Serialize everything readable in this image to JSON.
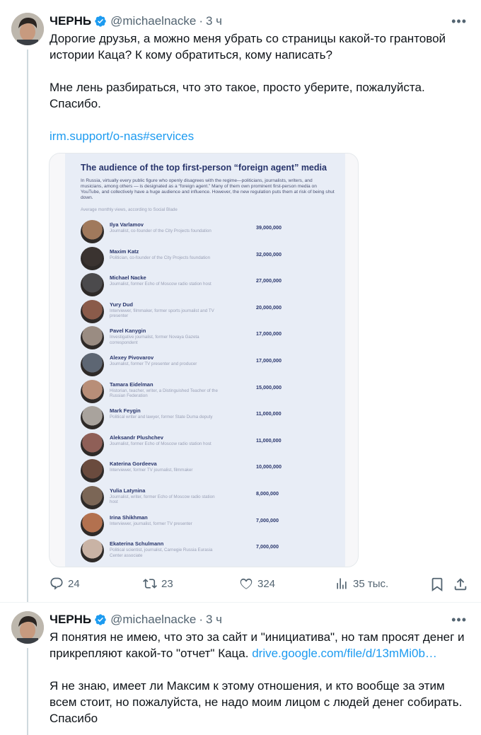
{
  "tweet1": {
    "author": {
      "name": "ЧЕРНЬ",
      "handle": "@michaelnacke",
      "time": "3 ч"
    },
    "paragraphs": [
      "Дорогие друзья, а можно меня убрать со страницы какой-то грантовой истории Каца? К кому обратиться, кому написать?",
      "Мне лень разбираться, что это такое, просто уберите, пожалуйста. Спасибо."
    ],
    "link": "irm.support/o-nas#services",
    "stats": {
      "replies": "24",
      "reposts": "23",
      "likes": "324",
      "views": "35 тыс."
    }
  },
  "infographic": {
    "title": "The audience of the top first-person “foreign agent” media",
    "description": "In Russia, virtually every public figure who openly disagrees with the regime—politicians, journalists, writers, and musicians, among others — is designated as a “foreign agent.” Many of them own prominent first-person media on YouTube, and collectively have a huge audience and influence. However, the new regulation puts them at risk of being shut down.",
    "note": "Average monthly views, according to Social Blade",
    "people": [
      {
        "name": "Ilya Varlamov",
        "desc": "Journalist, co-founder of the City Projects foundation",
        "views": "39,000,000",
        "color": "#a0795c"
      },
      {
        "name": "Maxim Katz",
        "desc": "Politician, co-founder of the City Projects foundation",
        "views": "32,000,000",
        "color": "#3a3330"
      },
      {
        "name": "Michael Nacke",
        "desc": "Journalist, former Echo of Moscow radio station host",
        "views": "27,000,000",
        "color": "#4b4a4c"
      },
      {
        "name": "Yury Dud",
        "desc": "Interviewer, filmmaker, former sports journalist and TV presenter",
        "views": "20,000,000",
        "color": "#8a5b4a"
      },
      {
        "name": "Pavel Kanygin",
        "desc": "Investigative journalist, former Novaya Gazeta correspondent",
        "views": "17,000,000",
        "color": "#9a8c82"
      },
      {
        "name": "Alexey Pivovarov",
        "desc": "Journalist, former TV presenter and producer",
        "views": "17,000,000",
        "color": "#5d6673"
      },
      {
        "name": "Tamara Eidelman",
        "desc": "Historian, teacher, writer, a Distinguished Teacher of the Russian Federation",
        "views": "15,000,000",
        "color": "#b88e78"
      },
      {
        "name": "Mark Feygin",
        "desc": "Political writer and lawyer, former State Duma deputy",
        "views": "11,000,000",
        "color": "#a9a39d"
      },
      {
        "name": "Aleksandr Plushchev",
        "desc": "Journalist, former Echo of Moscow radio station host",
        "views": "11,000,000",
        "color": "#8f5f57"
      },
      {
        "name": "Katerina Gordeeva",
        "desc": "Interviewer, former TV journalist, filmmaker",
        "views": "10,000,000",
        "color": "#6a4b3e"
      },
      {
        "name": "Yulia Latynina",
        "desc": "Journalist, writer, former Echo of Moscow radio station host",
        "views": "8,000,000",
        "color": "#7b6656"
      },
      {
        "name": "Irina Shikhman",
        "desc": "Interviewer, journalist, former TV presenter",
        "views": "7,000,000",
        "color": "#b3714f"
      },
      {
        "name": "Ekaterina Schulmann",
        "desc": "Political scientist, journalist, Carnegie Russia Eurasia Center associate",
        "views": "7,000,000",
        "color": "#c9b3a5"
      }
    ]
  },
  "tweet2": {
    "author": {
      "name": "ЧЕРНЬ",
      "handle": "@michaelnacke",
      "time": "3 ч"
    },
    "p1_start": "Я понятия не имею, что это за сайт и \"инициатива\", но там просят денег и прикрепляют какой-то \"отчет\" Каца.",
    "p1_link": "drive.google.com/file/d/13mMi0b…",
    "p2": "Я не знаю, имеет ли Максим к этому отношения, и кто вообще за этим всем стоит, но пожалуйста, не надо моим лицом с людей денег собирать. Спасибо"
  },
  "colors": {
    "accent": "#1d9bf0",
    "muted": "#536471",
    "text": "#0f1419"
  },
  "icons": [
    "reply-icon",
    "repost-icon",
    "like-icon",
    "views-icon",
    "bookmark-icon",
    "share-icon",
    "verified-icon",
    "more-icon"
  ]
}
